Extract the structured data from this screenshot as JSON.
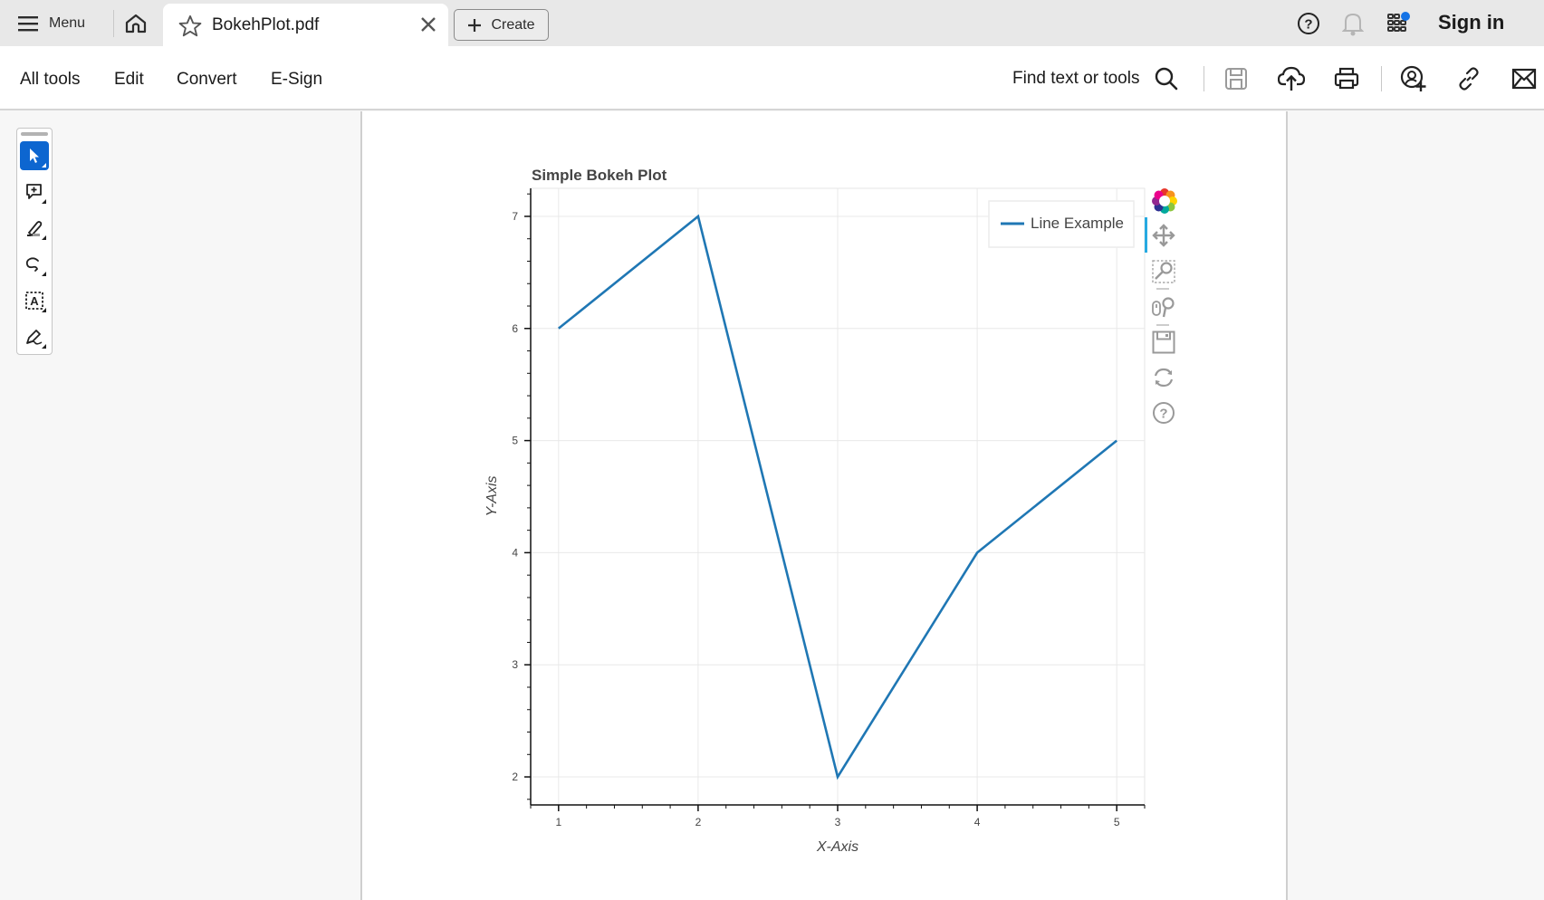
{
  "topbar": {
    "menu_label": "Menu",
    "tab_title": "BokehPlot.pdf",
    "create_label": "Create",
    "sign_in_label": "Sign in",
    "icons": [
      "hamburger-icon",
      "home-icon",
      "star-icon",
      "close-icon",
      "plus-icon",
      "help-icon",
      "bell-icon",
      "apps-grid-icon"
    ],
    "notification_dot_color": "#1473e6"
  },
  "toolbar": {
    "nav": [
      "All tools",
      "Edit",
      "Convert",
      "E-Sign"
    ],
    "find_label": "Find text or tools",
    "icons": [
      "search-icon",
      "save-icon",
      "cloud-upload-icon",
      "print-icon",
      "share-user-icon",
      "link-icon",
      "email-icon"
    ]
  },
  "tools_panel": {
    "items": [
      {
        "name": "select-tool",
        "icon": "cursor-icon",
        "active": true
      },
      {
        "name": "comment-tool",
        "icon": "add-comment-icon",
        "active": false
      },
      {
        "name": "highlight-tool",
        "icon": "highlighter-icon",
        "active": false
      },
      {
        "name": "draw-tool",
        "icon": "freehand-icon",
        "active": false
      },
      {
        "name": "text-select-tool",
        "icon": "text-box-icon",
        "active": false
      },
      {
        "name": "sign-tool",
        "icon": "pen-sign-icon",
        "active": false
      }
    ],
    "active_color": "#0d66d0"
  },
  "bokeh_toolbar": {
    "tools": [
      "bokeh-logo-icon",
      "pan-icon",
      "box-zoom-icon",
      "wheel-zoom-icon",
      "save-icon",
      "reset-icon",
      "help-icon"
    ],
    "active_indicator_color": "#26aae1"
  },
  "chart_data": {
    "type": "line",
    "title": "Simple Bokeh Plot",
    "xlabel": "X-Axis",
    "ylabel": "Y-Axis",
    "x": [
      1,
      2,
      3,
      4,
      5
    ],
    "series": [
      {
        "name": "Line Example",
        "values": [
          6,
          7,
          2,
          4,
          5
        ],
        "color": "#1f77b4"
      }
    ],
    "xlim": [
      0.8,
      5.2
    ],
    "ylim": [
      1.75,
      7.25
    ],
    "x_ticks": [
      "1",
      "2",
      "3",
      "4",
      "5"
    ],
    "y_ticks": [
      "2",
      "3",
      "4",
      "5",
      "6",
      "7"
    ],
    "grid": true,
    "legend_position": "top-right"
  }
}
